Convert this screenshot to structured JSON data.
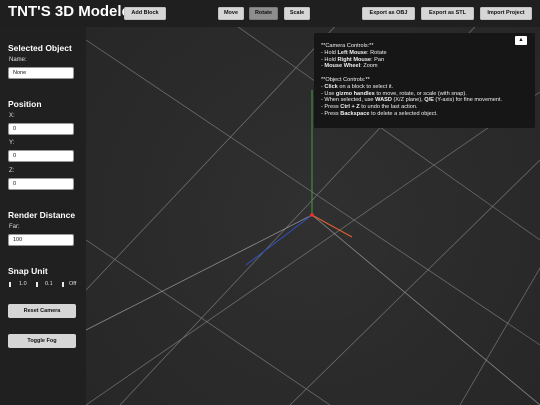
{
  "app_title": "TNT'S 3D Modeler",
  "toolbar": {
    "add_block": "Add Block",
    "move": "Move",
    "rotate": "Rotate",
    "scale": "Scale",
    "export_obj": "Export as OBJ",
    "export_stl": "Export as STL",
    "import_project": "Import Project"
  },
  "active_tool": "Rotate",
  "sidebar": {
    "selected_object": {
      "title": "Selected Object",
      "name_label": "Name:",
      "name_value": "None"
    },
    "position": {
      "title": "Position",
      "x_label": "X:",
      "x_value": "0",
      "y_label": "Y:",
      "y_value": "0",
      "z_label": "Z:",
      "z_value": "0"
    },
    "render_distance": {
      "title": "Render Distance",
      "far_label": "Far:",
      "far_value": "100"
    },
    "snap_unit": {
      "title": "Snap Unit",
      "options": [
        "1.0",
        "0.1",
        "Off"
      ]
    },
    "reset_camera": "Reset Camera",
    "toggle_fog": "Toggle Fog"
  },
  "help_panel": {
    "toggle_glyph": "▲",
    "lines": [
      [
        {
          "t": "**Camera Controls:**"
        }
      ],
      [
        {
          "t": "- Hold "
        },
        {
          "t": "Left Mouse",
          "b": true
        },
        {
          "t": ": Rotate"
        }
      ],
      [
        {
          "t": "- Hold "
        },
        {
          "t": "Right Mouse",
          "b": true
        },
        {
          "t": ": Pan"
        }
      ],
      [
        {
          "t": "- "
        },
        {
          "t": "Mouse Wheel",
          "b": true
        },
        {
          "t": ": Zoom"
        }
      ],
      [
        {
          "t": ""
        }
      ],
      [
        {
          "t": "**Object Controls:**"
        }
      ],
      [
        {
          "t": "- "
        },
        {
          "t": "Click",
          "b": true
        },
        {
          "t": " on a block to select it."
        }
      ],
      [
        {
          "t": "- Use "
        },
        {
          "t": "gizmo handles",
          "b": true
        },
        {
          "t": " to move, rotate, or scale (with snap)."
        }
      ],
      [
        {
          "t": "- When selected, use "
        },
        {
          "t": "WASD",
          "b": true
        },
        {
          "t": " (X/Z plane), "
        },
        {
          "t": "Q/E",
          "b": true
        },
        {
          "t": " (Y-axis) for fine movement."
        }
      ],
      [
        {
          "t": "- Press "
        },
        {
          "t": "Ctrl + Z",
          "b": true
        },
        {
          "t": " to undo the last action."
        }
      ],
      [
        {
          "t": "- Press "
        },
        {
          "t": "Backspace",
          "b": true
        },
        {
          "t": " to delete a selected object."
        }
      ]
    ]
  },
  "colors": {
    "background": "#2a2a2a",
    "panel": "#202020",
    "grid": "#a0a0a0",
    "axis_x": "#e06030",
    "axis_y": "#40a040",
    "axis_z": "#3050c0",
    "origin": "#ff2a2a"
  }
}
